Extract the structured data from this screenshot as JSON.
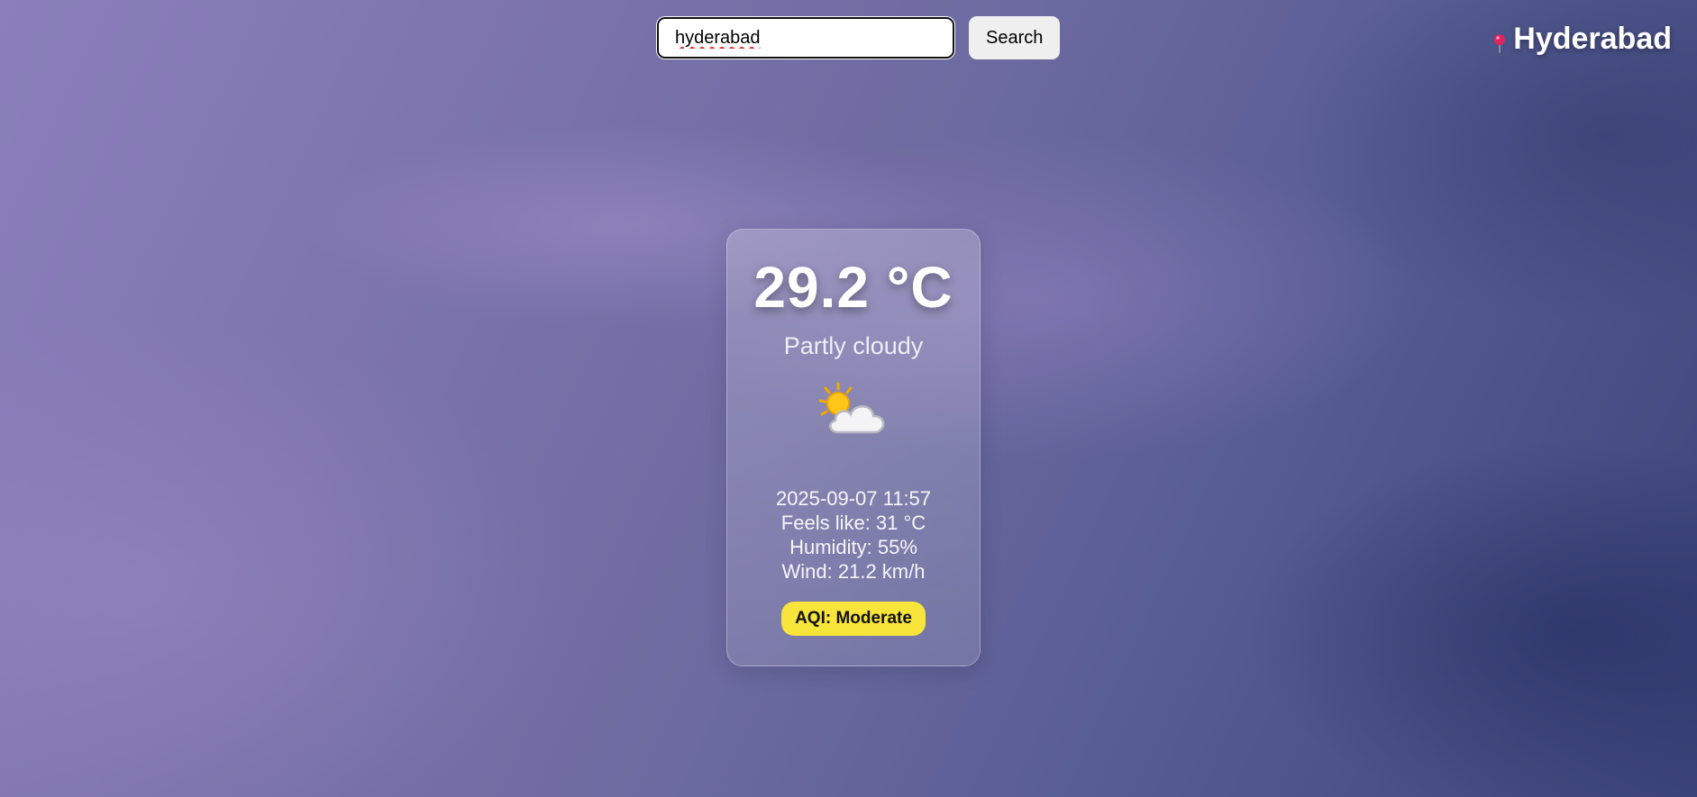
{
  "search": {
    "value": "hyderabad",
    "button_label": "Search"
  },
  "location": {
    "icon": "map-pin-icon",
    "city": "Hyderabad"
  },
  "weather": {
    "temperature": "29.2 °C",
    "condition": "Partly cloudy",
    "icon": "partly-cloudy-icon",
    "datetime": "2025-09-07 11:57",
    "feels_like": "Feels like: 31 °C",
    "humidity": "Humidity: 55%",
    "wind": "Wind: 21.2 km/h",
    "aqi": "AQI: Moderate"
  },
  "colors": {
    "aqi_badge": "#f7e53b",
    "pin": "#e0245e"
  }
}
